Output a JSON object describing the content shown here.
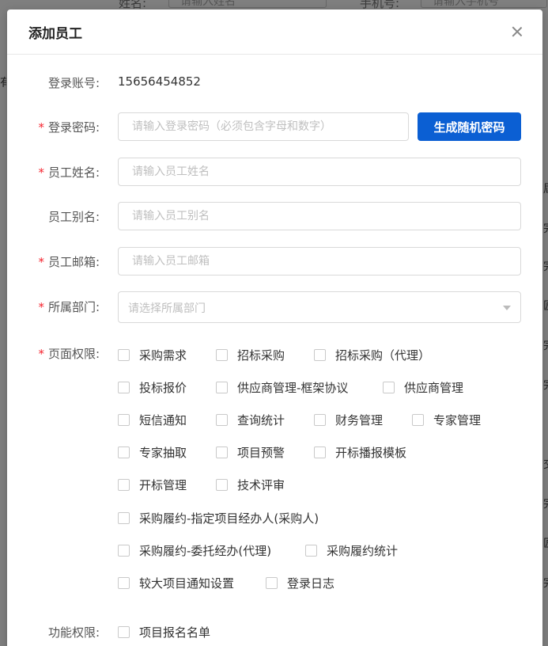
{
  "background": {
    "name_label": "姓名:",
    "name_placeholder": "请输入姓名",
    "phone_label": "手机号:",
    "phone_placeholder": "请输入手机号",
    "left_fragment": "有",
    "right_fragments": [
      "屆",
      "完",
      "完",
      "匠",
      "完",
      "完",
      "交",
      "完",
      "匠",
      "完"
    ]
  },
  "dialog": {
    "title": "添加员工",
    "close_icon": "close-icon"
  },
  "form": {
    "account": {
      "label": "登录账号:",
      "value": "15656454852"
    },
    "password": {
      "label": "登录密码:",
      "placeholder": "请输入登录密码（必须包含字母和数字）",
      "button": "生成随机密码"
    },
    "name": {
      "label": "员工姓名:",
      "placeholder": "请输入员工姓名"
    },
    "alias": {
      "label": "员工别名:",
      "placeholder": "请输入员工别名"
    },
    "email": {
      "label": "员工邮箱:",
      "placeholder": "请输入员工邮箱"
    },
    "department": {
      "label": "所属部门:",
      "placeholder": "请选择所属部门"
    },
    "page_perm": {
      "label": "页面权限:",
      "options": [
        "采购需求",
        "招标采购",
        "招标采购（代理）",
        "投标报价",
        "供应商管理-框架协议",
        "供应商管理",
        "短信通知",
        "查询统计",
        "财务管理",
        "专家管理",
        "专家抽取",
        "项目预警",
        "开标播报模板",
        "开标管理",
        "技术评审",
        "采购履约-指定项目经办人(采购人)",
        "采购履约-委托经办(代理)",
        "采购履约统计",
        "较大项目通知设置",
        "登录日志"
      ]
    },
    "func_perm": {
      "label": "功能权限:",
      "options": [
        "项目报名名单"
      ]
    },
    "required_mark": "*"
  }
}
